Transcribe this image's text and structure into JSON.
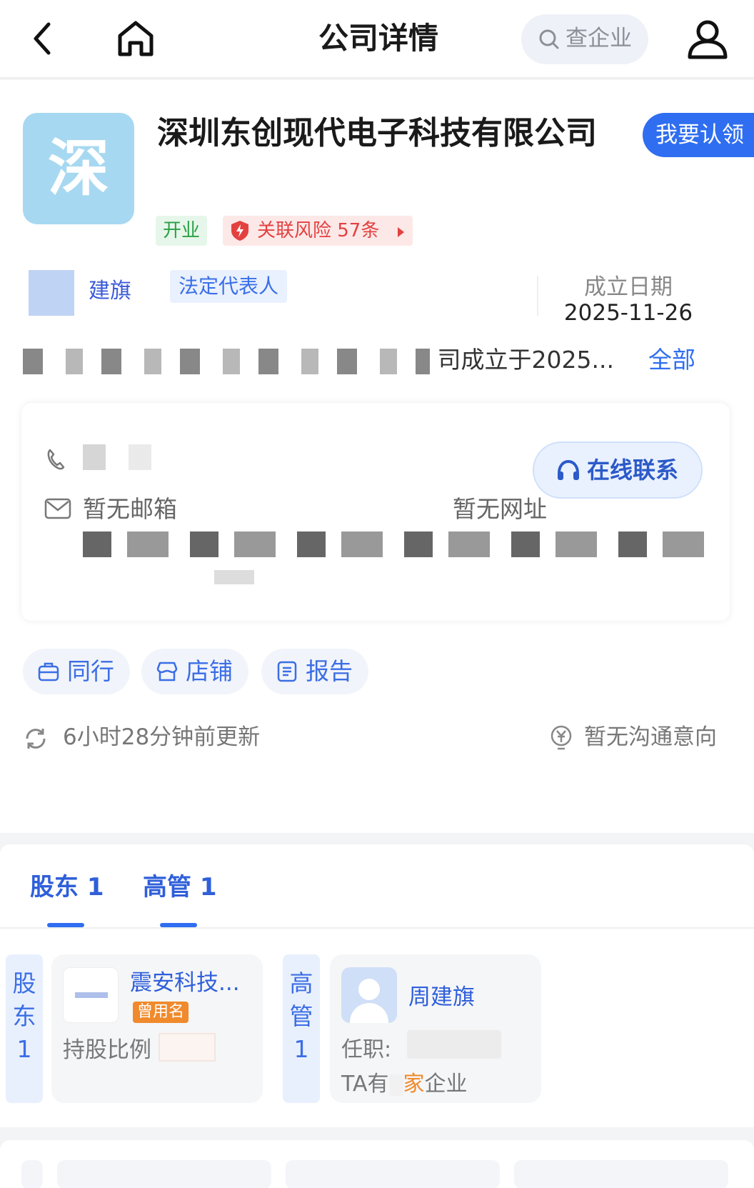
{
  "topbar": {
    "title": "公司详情",
    "search_placeholder": "查企业"
  },
  "company": {
    "logo_char": "深",
    "name": "深圳东创现代电子科技有限公司",
    "claim_label": "我要认领",
    "status": "开业",
    "risk_label": "关联风险 57条",
    "legal_rep_name_visible": "建旗",
    "legal_rep_tag": "法定代表人",
    "established_label": "成立日期",
    "established_date": "2025-11-26",
    "intro_tail": "司成立于2025...",
    "intro_all": "全部"
  },
  "contact": {
    "online_label": "在线联系",
    "email": "暂无邮箱",
    "website": "暂无网址"
  },
  "quick_actions": [
    {
      "label": "同行"
    },
    {
      "label": "店铺"
    },
    {
      "label": "报告"
    }
  ],
  "update_text": "6小时28分钟前更新",
  "intent_text": "暂无沟通意向",
  "tabs": [
    {
      "label": "股东 1"
    },
    {
      "label": "高管 1"
    }
  ],
  "shareholders": {
    "vertical_label": [
      "股",
      "东",
      "1"
    ],
    "name": "震安科技...",
    "badge": "曾用名",
    "ratio_label": "持股比例"
  },
  "managers": {
    "vertical_label": [
      "高",
      "管",
      "1"
    ],
    "name": "周建旗",
    "role_label": "任职:",
    "ta_prefix": "TA有",
    "ta_suffix_accent": "家",
    "ta_suffix": "企业"
  },
  "colors": {
    "accent_blue": "#2f6ef0",
    "risk_red": "#e34140",
    "open_green": "#2aa046",
    "badge_orange": "#f08a2c"
  }
}
